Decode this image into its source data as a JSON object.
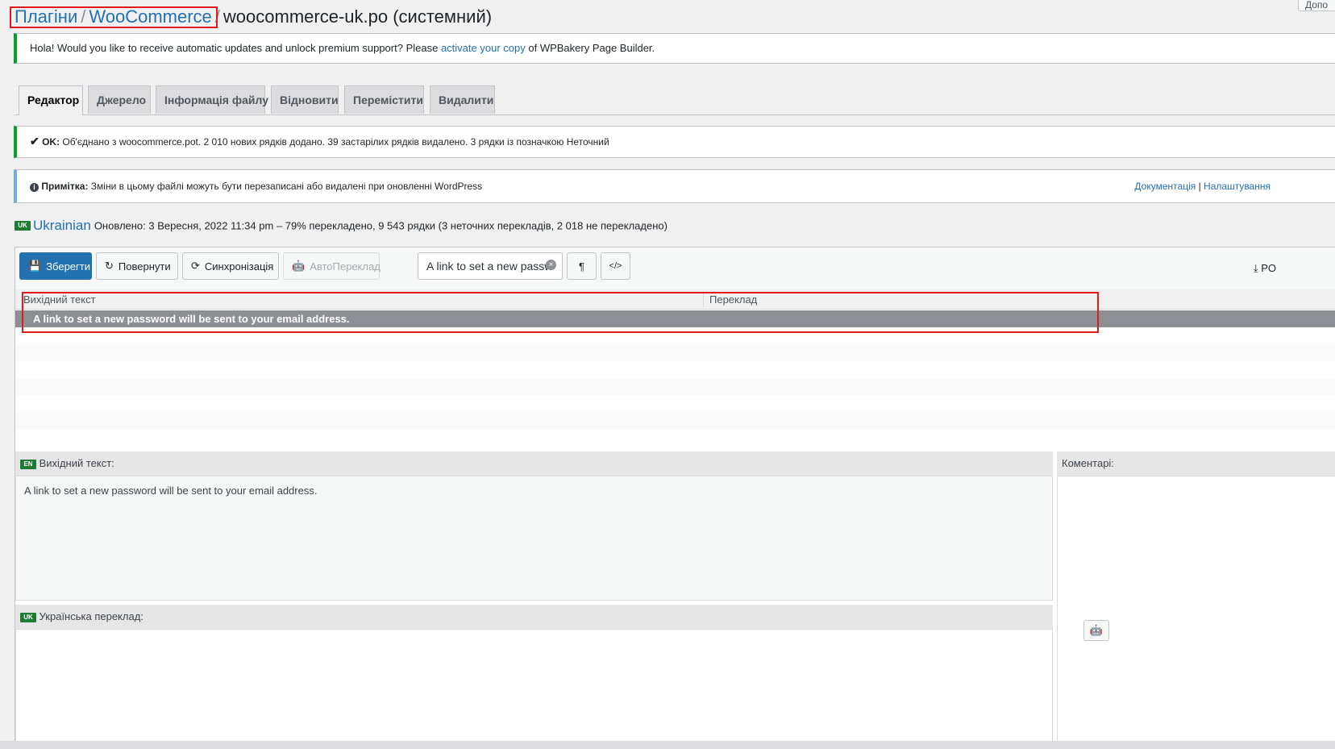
{
  "breadcrumb": {
    "plugins": "Плагіни",
    "sep1": "/",
    "woocommerce": "WooCommerce",
    "sep2": "/",
    "current": "woocommerce-uk.po (системний)"
  },
  "top_button": "Допо",
  "notice_wpbakery": {
    "before": "Hola! Would you like to receive automatic updates and unlock premium support? Please",
    "link": "activate your copy",
    "after": "of WPBakery Page Builder."
  },
  "tabs": [
    "Редактор",
    "Джерело",
    "Інформація файлу",
    "Відновити",
    "Перемістити",
    "Видалити"
  ],
  "notice_ok": {
    "label": "OK:",
    "text": "Об'єднано з woocommerce.pot. 2 010 нових рядків додано. 39 застарілих рядків видалено. 3 рядки із позначкою Неточний"
  },
  "notice_note": {
    "label": "Примітка:",
    "text": "Зміни в цьому файлі можуть бути перезаписані або видалені при оновленні WordPress",
    "link1": "Документація",
    "sep": "|",
    "link2": "Налаштування"
  },
  "language": {
    "code": "UK",
    "name": "Ukrainian",
    "status": "Оновлено: 3 Вересня, 2022 11:34 pm – 79% перекладено, 9 543 рядки (3 неточних перекладів, 2 018 не перекладено)"
  },
  "toolbar": {
    "save": "Зберегти",
    "revert": "Повернути",
    "sync": "Синхронізація",
    "auto": "АвтоПереклад",
    "search_value": "A link to set a new password",
    "pilcrow": "¶",
    "code": "</>",
    "download": "PO"
  },
  "grid": {
    "col_source": "Вихідний текст",
    "col_translation": "Переклад",
    "selected_row": "A link to set a new password will be sent to your email address."
  },
  "source_pane": {
    "code": "EN",
    "title": "Вихідний текст:",
    "text": "A link to set a new password will be sent to your email address."
  },
  "comments_pane": {
    "title": "Коментарі:"
  },
  "translation_pane": {
    "code": "UK",
    "title": "Українська переклад:"
  },
  "colors": {
    "primary": "#2271b1",
    "success": "#00a32a",
    "info": "#72aee6",
    "highlight": "#e01b1b",
    "selected_row": "#8c8f94"
  },
  "icons": [
    "check-icon",
    "info-icon",
    "save-icon",
    "undo-icon",
    "sync-icon",
    "robot-icon",
    "download-icon",
    "clear-icon"
  ]
}
